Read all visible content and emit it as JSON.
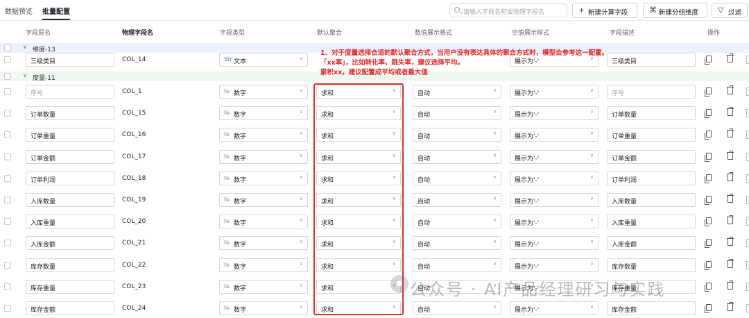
{
  "tabs": [
    {
      "label": "数据预览"
    },
    {
      "label": "批量配置"
    }
  ],
  "toolbar": {
    "search_placeholder": "请输入字段名称或物理字段名",
    "new_calc_field": "新建计算字段",
    "new_group_dim": "新建分组维度",
    "filter": "过滤"
  },
  "columns": [
    "字段原名",
    "物理字段名",
    "字段类型",
    "默认聚合",
    "数值展示格式",
    "空值展示样式",
    "字段描述",
    "操作"
  ],
  "groups": {
    "dimension": "维度-13",
    "measure": "度量-11"
  },
  "dimension_rows": [
    {
      "name": "三级类目",
      "phys": "COL_14",
      "type_tag": "Str",
      "type": "文本",
      "agg": "",
      "fmt": "",
      "null_style": "展示为'-'",
      "desc": "三级类目"
    }
  ],
  "measure_rows": [
    {
      "name": "",
      "name_placeholder": "序号",
      "phys": "COL_1",
      "type_tag": "№",
      "type": "数字",
      "agg": "求和",
      "fmt": "自动",
      "null_style": "展示为'-'",
      "desc": "",
      "desc_placeholder": "序号"
    },
    {
      "name": "订单数量",
      "phys": "COL_15",
      "type_tag": "№",
      "type": "数字",
      "agg": "求和",
      "fmt": "自动",
      "null_style": "展示为'-'",
      "desc": "订单数量"
    },
    {
      "name": "订单重量",
      "phys": "COL_16",
      "type_tag": "№",
      "type": "数字",
      "agg": "求和",
      "fmt": "自动",
      "null_style": "展示为'-'",
      "desc": "订单重量"
    },
    {
      "name": "订单金额",
      "phys": "COL_17",
      "type_tag": "№",
      "type": "数字",
      "agg": "求和",
      "fmt": "自动",
      "null_style": "展示为'-'",
      "desc": "订单金额"
    },
    {
      "name": "订单利润",
      "phys": "COL_18",
      "type_tag": "№",
      "type": "数字",
      "agg": "求和",
      "fmt": "自动",
      "null_style": "展示为'-'",
      "desc": "订单利润"
    },
    {
      "name": "入库数量",
      "phys": "COL_19",
      "type_tag": "№",
      "type": "数字",
      "agg": "求和",
      "fmt": "自动",
      "null_style": "展示为'-'",
      "desc": "入库数量"
    },
    {
      "name": "入库重量",
      "phys": "COL_20",
      "type_tag": "№",
      "type": "数字",
      "agg": "求和",
      "fmt": "自动",
      "null_style": "展示为'-'",
      "desc": "入库重量"
    },
    {
      "name": "入库金额",
      "phys": "COL_21",
      "type_tag": "№",
      "type": "数字",
      "agg": "求和",
      "fmt": "自动",
      "null_style": "展示为'-'",
      "desc": "入库金额"
    },
    {
      "name": "库存数量",
      "phys": "COL_22",
      "type_tag": "№",
      "type": "数字",
      "agg": "求和",
      "fmt": "自动",
      "null_style": "展示为'-'",
      "desc": "库存数量"
    },
    {
      "name": "库存重量",
      "phys": "COL_23",
      "type_tag": "№",
      "type": "数字",
      "agg": "求和",
      "fmt": "自动",
      "null_style": "展示为'-'",
      "desc": "库存重量"
    },
    {
      "name": "库存金额",
      "phys": "COL_24",
      "type_tag": "№",
      "type": "数字",
      "agg": "求和",
      "fmt": "自动",
      "null_style": "展示为'-'",
      "desc": "库存金额"
    }
  ],
  "annotation": {
    "line1": "1、对于度量选择合适的默认聚合方式，当用户没有表达具体的聚合方式时，模型会参考这一配置。",
    "line2": "「xx率」，比如转化率，跳失率，建议选择平均。",
    "line3": "累积xx，建议配置成平均或者最大值",
    "color": "#e62b2b"
  },
  "watermark": "公众号 · AI产品经理研习与实践"
}
